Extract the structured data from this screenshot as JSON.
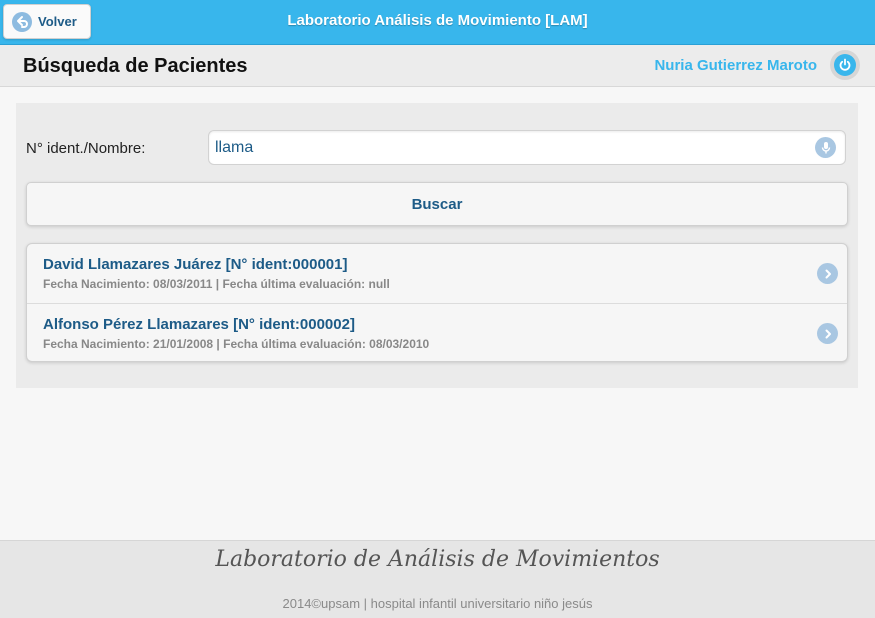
{
  "topbar": {
    "back_label": "Volver",
    "app_title": "Laboratorio Análisis de Movimiento [LAM]"
  },
  "header": {
    "page_title": "Búsqueda de Pacientes",
    "user_name": "Nuria Gutierrez Maroto"
  },
  "search": {
    "label": "N° ident./Nombre:",
    "value": "llama",
    "button_label": "Buscar"
  },
  "results": [
    {
      "title": "David Llamazares Juárez [N° ident:000001]",
      "subtitle": "Fecha Nacimiento: 08/03/2011 | Fecha última evaluación: null"
    },
    {
      "title": "Alfonso Pérez Llamazares [N° ident:000002]",
      "subtitle": "Fecha Nacimiento: 21/01/2008 | Fecha última evaluación: 08/03/2010"
    }
  ],
  "footer": {
    "brand": "Laboratorio de Análisis de Movimientos",
    "credit": "2014©upsam | hospital infantil universitario niño jesús"
  },
  "colors": {
    "topbar": "#38b6ec",
    "link": "#1d5b87",
    "icon_circle": "#a9c7e2"
  },
  "icons": {
    "back": "back-arrow-icon",
    "power": "power-icon",
    "mic": "microphone-icon",
    "chevron": "chevron-right-icon"
  }
}
